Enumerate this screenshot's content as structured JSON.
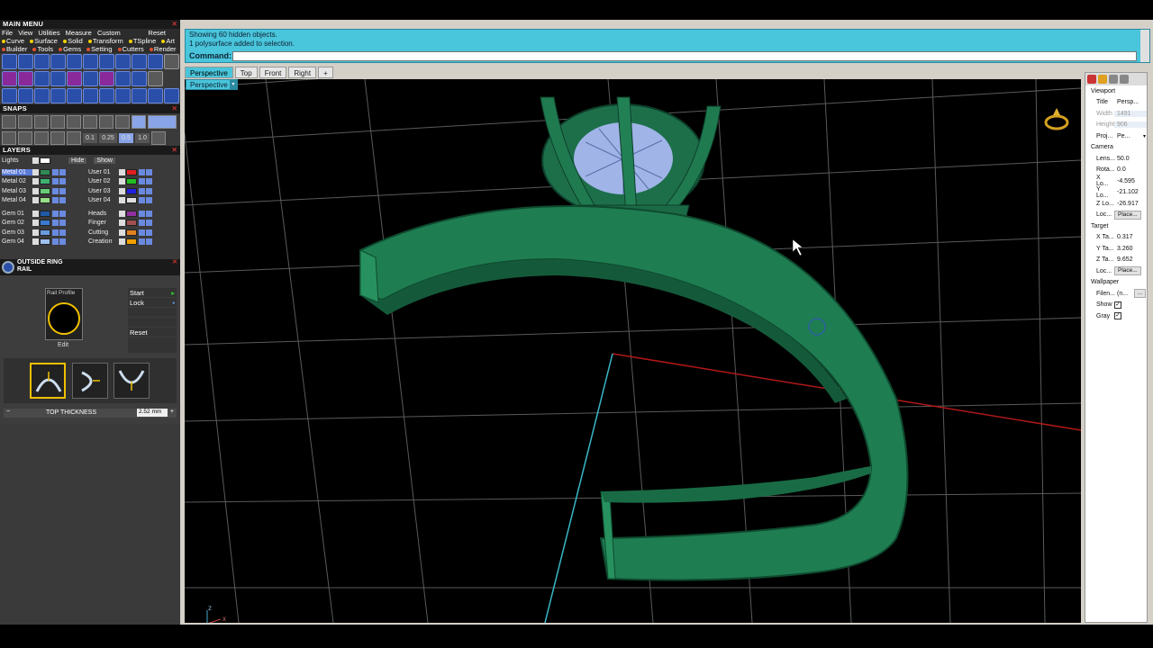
{
  "main_menu": {
    "title": "MAIN MENU",
    "menu_items": [
      "File",
      "View",
      "Utilities",
      "Measure",
      "Custom"
    ],
    "reset_label": "Reset",
    "categories_row1": [
      "Curve",
      "Surface",
      "Solid",
      "Transform",
      "TSpline",
      "Art"
    ],
    "categories_row2": [
      "Builder",
      "Tools",
      "Gems",
      "Setting",
      "Cutters",
      "Render"
    ]
  },
  "snaps": {
    "title": "SNAPS",
    "values": [
      "0.1",
      "0.25",
      "0.5",
      "1.0"
    ]
  },
  "layers": {
    "title": "LAYERS",
    "lights_label": "Lights",
    "hide_label": "Hide",
    "show_label": "Show",
    "left": [
      {
        "name": "Metal 01",
        "color": "#2e8b57"
      },
      {
        "name": "Metal 02",
        "color": "#3cb371"
      },
      {
        "name": "Metal 03",
        "color": "#66cc77"
      },
      {
        "name": "Metal 04",
        "color": "#99dd88"
      },
      {
        "name": "Gem 01",
        "color": "#1e5aa8"
      },
      {
        "name": "Gem 02",
        "color": "#3a7ad0"
      },
      {
        "name": "Gem 03",
        "color": "#6a9ae0"
      },
      {
        "name": "Gem 04",
        "color": "#a0c0f0"
      }
    ],
    "right": [
      {
        "name": "User 01",
        "color": "#e02020"
      },
      {
        "name": "User 02",
        "color": "#20c020"
      },
      {
        "name": "User 03",
        "color": "#2020e0"
      },
      {
        "name": "User 04",
        "color": "#e0e0e0"
      },
      {
        "name": "Heads",
        "color": "#9030a0"
      },
      {
        "name": "Finger",
        "color": "#a05050"
      },
      {
        "name": "Cutting",
        "color": "#e08020"
      },
      {
        "name": "Creation",
        "color": "#f0a000"
      }
    ]
  },
  "outside_ring": {
    "title_line1": "OUTSIDE RING",
    "title_line2": "RAIL",
    "rail_profile_label": "Rail Profile",
    "edit_label": "Edit",
    "start_label": "Start",
    "lock_label": "Lock",
    "reset_label": "Reset",
    "thickness_label": "TOP THICKNESS",
    "thickness_value": "2.52 mm"
  },
  "command": {
    "line1": "Showing 60 hidden objects.",
    "line2": "1 polysurface added to selection.",
    "prompt": "Command:"
  },
  "tabs": [
    "Perspective",
    "Top",
    "Front",
    "Right"
  ],
  "tab_add": "+",
  "viewport_label": "Perspective",
  "properties": {
    "viewport_section": "Viewport",
    "title_key": "Title",
    "title_val": "Persp...",
    "width_key": "Width",
    "width_val": "1491",
    "height_key": "Height",
    "height_val": "906",
    "proj_key": "Proj...",
    "proj_val": "Pe...",
    "camera_section": "Camera",
    "lens_key": "Lens...",
    "lens_val": "50.0",
    "rota_key": "Rota...",
    "rota_val": "0.0",
    "xloc_key": "X Lo...",
    "xloc_val": "-4.595",
    "yloc_key": "Y Lo...",
    "yloc_val": "-21.102",
    "zloc_key": "Z Lo...",
    "zloc_val": "-26.917",
    "loc_key": "Loc...",
    "place_label": "Place...",
    "target_section": "Target",
    "xtar_key": "X Ta...",
    "xtar_val": "0.317",
    "ytar_key": "Y Ta...",
    "ytar_val": "3.260",
    "ztar_key": "Z Ta...",
    "ztar_val": "9.652",
    "tloc_key": "Loc...",
    "tplace_label": "Place...",
    "wallpaper_section": "Wallpaper",
    "filename_key": "Filen...",
    "filename_val": "(n...",
    "show_key": "Show",
    "gray_key": "Gray"
  },
  "axis_labels": {
    "z": "z",
    "x": "x",
    "y": "y"
  }
}
